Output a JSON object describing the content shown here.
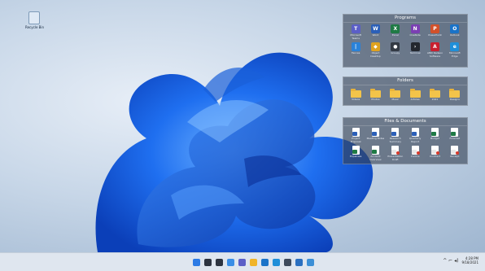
{
  "desktop": {
    "recycle_bin": {
      "label": "Recycle Bin",
      "icon": "recycle-bin-icon"
    }
  },
  "fences": [
    {
      "title": "Programs",
      "items": [
        {
          "label": "Microsoft Teams",
          "icon": "teams-icon",
          "glyph": "T",
          "color": "#5b5fc7"
        },
        {
          "label": "Word",
          "icon": "word-icon",
          "glyph": "W",
          "color": "#2b5fb8"
        },
        {
          "label": "Excel",
          "icon": "excel-icon",
          "glyph": "X",
          "color": "#1f7a45"
        },
        {
          "label": "OneNote",
          "icon": "onenote-icon",
          "glyph": "N",
          "color": "#7b3fb3"
        },
        {
          "label": "PowerPoint",
          "icon": "powerpoint-icon",
          "glyph": "P",
          "color": "#d2512b"
        },
        {
          "label": "Outlook",
          "icon": "outlook-icon",
          "glyph": "O",
          "color": "#1a73c8"
        },
        {
          "label": "Fences",
          "icon": "fences-icon",
          "glyph": "|",
          "color": "#2a82d8"
        },
        {
          "label": "Object Desktop",
          "icon": "cube-icon",
          "glyph": "◆",
          "color": "#e0a21f"
        },
        {
          "label": "Groupy",
          "icon": "groupy-icon",
          "glyph": "●",
          "color": "#333a44"
        },
        {
          "label": "Terminal",
          "icon": "terminal-icon",
          "glyph": "›",
          "color": "#23272e"
        },
        {
          "label": "AMD Radeon Software",
          "icon": "amd-icon",
          "glyph": "A",
          "color": "#c8202f"
        },
        {
          "label": "Microsoft Edge",
          "icon": "edge-icon",
          "glyph": "e",
          "color": "#1f8fd9"
        }
      ]
    },
    {
      "title": "Folders",
      "items": [
        {
          "label": "Videos",
          "icon": "folder-icon"
        },
        {
          "label": "Photos",
          "icon": "folder-icon"
        },
        {
          "label": "Music",
          "icon": "folder-icon"
        },
        {
          "label": "Articles",
          "icon": "folder-icon"
        },
        {
          "label": "2021",
          "icon": "folder-icon"
        },
        {
          "label": "Designs",
          "icon": "folder-icon"
        }
      ]
    },
    {
      "title": "Files & Documents",
      "items": [
        {
          "label": "Project Proposal",
          "icon": "word-doc-icon",
          "kind": "word"
        },
        {
          "label": "Meeting Notes",
          "icon": "word-doc-icon",
          "kind": "word"
        },
        {
          "label": "Research Summary",
          "icon": "word-doc-icon",
          "kind": "word"
        },
        {
          "label": "Quarterly Report",
          "icon": "word-doc-icon",
          "kind": "word"
        },
        {
          "label": "Budget",
          "icon": "excel-doc-icon",
          "kind": "excel"
        },
        {
          "label": "Forecast",
          "icon": "excel-doc-icon",
          "kind": "excel"
        },
        {
          "label": "Expenses",
          "icon": "excel-doc-icon",
          "kind": "excel"
        },
        {
          "label": "Account Overview",
          "icon": "excel-doc-icon",
          "kind": "excel"
        },
        {
          "label": "Presentation Draft",
          "icon": "pdf-doc-icon",
          "kind": "pdf"
        },
        {
          "label": "Invoice",
          "icon": "pdf-doc-icon",
          "kind": "pdf"
        },
        {
          "label": "Contract",
          "icon": "pdf-doc-icon",
          "kind": "pdf"
        },
        {
          "label": "Receipt",
          "icon": "pdf-doc-icon",
          "kind": "pdf"
        }
      ]
    }
  ],
  "taskbar": {
    "icons": [
      {
        "name": "start-icon",
        "color": "#2c7be5"
      },
      {
        "name": "search-icon",
        "color": "#2d3440"
      },
      {
        "name": "task-view-icon",
        "color": "#2d3440"
      },
      {
        "name": "widgets-icon",
        "color": "#3a8ee6"
      },
      {
        "name": "chat-icon",
        "color": "#5b5fc7"
      },
      {
        "name": "file-explorer-icon",
        "color": "#f0b429"
      },
      {
        "name": "mail-icon",
        "color": "#1a73c8"
      },
      {
        "name": "edge-icon",
        "color": "#1f8fd9"
      },
      {
        "name": "store-icon",
        "color": "#3d4a5c"
      },
      {
        "name": "fences-taskbar-icon",
        "color": "#2a6fc0"
      },
      {
        "name": "photos-icon",
        "color": "#3c8fd6"
      }
    ],
    "tray_symbols": "^  ⌐  ◂)",
    "clock": {
      "time": "4:28 PM",
      "date": "9/18/2021"
    }
  },
  "colors": {
    "bloom_dark": "#0b3fb8",
    "bloom_mid": "#1f6ff0",
    "bloom_light": "#6fb3ff"
  }
}
